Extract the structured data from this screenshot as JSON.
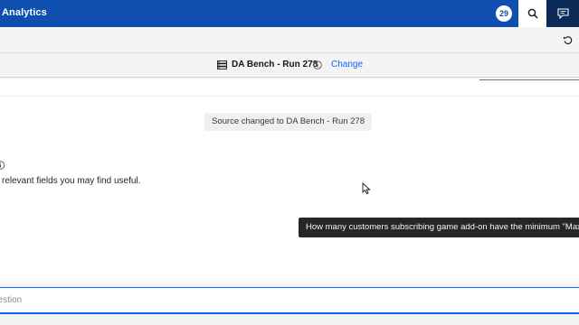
{
  "header": {
    "app_title": "Analytics",
    "notification_count": "29",
    "icons": [
      "search-icon",
      "chat-icon"
    ],
    "brand_color": "#0f4fb0",
    "active_color": "#0b2a58"
  },
  "toolbar": {
    "reset_icon": "reset-icon"
  },
  "source": {
    "icon": "database-icon",
    "name": "DA Bench - Run 278",
    "info_icon": "info-icon",
    "change_label": "Change"
  },
  "chat": {
    "system_message": "Source changed to DA Bench - Run 278",
    "assistant_text": "relevant fields you may find useful.",
    "tooltip": "How many customers subscribing game add-on have the minimum \"Max D"
  },
  "input": {
    "placeholder": "uestion",
    "value": ""
  }
}
